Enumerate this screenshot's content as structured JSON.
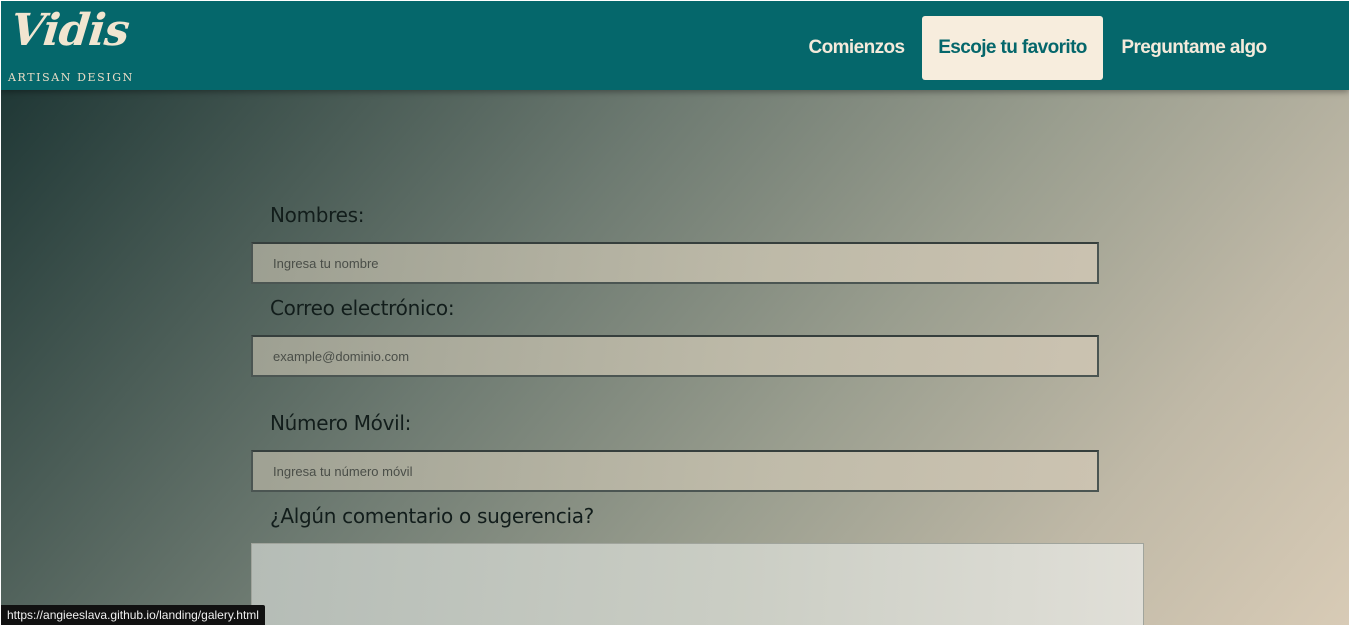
{
  "brand": {
    "script_name": "Vidis",
    "tagline": "ARTISAN DESIGN"
  },
  "nav": {
    "items": [
      {
        "label": "Comienzos",
        "active": false
      },
      {
        "label": "Escoje tu favorito",
        "active": true
      },
      {
        "label": "Preguntame algo",
        "active": false
      }
    ]
  },
  "form": {
    "name": {
      "label": "Nombres:",
      "placeholder": "Ingresa tu nombre"
    },
    "email": {
      "label": "Correo electrónico:",
      "placeholder": "example@dominio.com"
    },
    "phone": {
      "label": "Número Móvil:",
      "placeholder": "Ingresa tu número móvil"
    },
    "comment": {
      "label": "¿Algún comentario o sugerencia?",
      "placeholder": ""
    }
  },
  "status_bar": {
    "url": "https://angieeslava.github.io/landing/galery.html"
  },
  "colors": {
    "navbar": "#05676b",
    "nav_active_bg": "#f7eddd",
    "nav_text": "#f4eadb"
  }
}
